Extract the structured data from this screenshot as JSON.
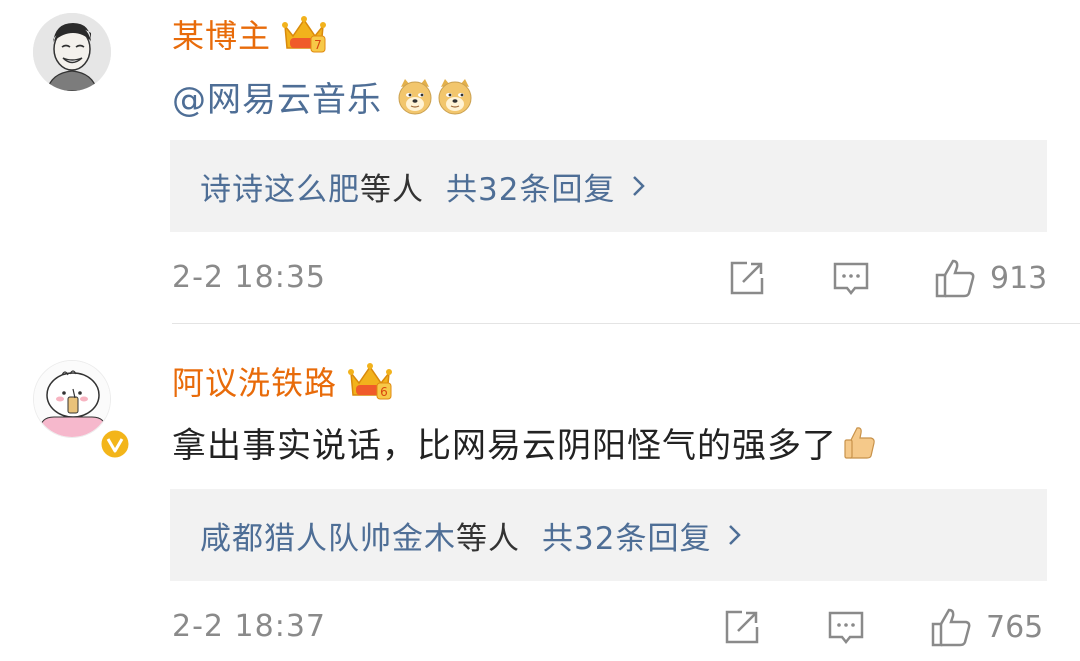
{
  "comments": [
    {
      "author": "某博主",
      "crown_level": "7",
      "mention": "@网易云音乐",
      "emojis": [
        "doge-emoji",
        "doge-emoji"
      ],
      "reply_names": "诗诗这么肥",
      "reply_wait": "等人",
      "reply_count": "共32条回复",
      "time": "2-2 18:35",
      "likes": "913"
    },
    {
      "author": "阿议洗铁路",
      "crown_level": "6",
      "text": "拿出事实说话，比网易云阴阳怪气的强多了",
      "emojis": [
        "thumbs-up-emoji"
      ],
      "verified": true,
      "reply_names": "咸都猎人队帅金木",
      "reply_wait": "等人",
      "reply_count": "共32条回复",
      "time": "2-2 18:37",
      "likes": "765"
    }
  ],
  "colors": {
    "author": "#e86b0a",
    "link": "#4e6e96",
    "meta": "#8a8a8a",
    "reply_bg": "#f2f2f2",
    "verified_badge": "#f3b51a"
  }
}
